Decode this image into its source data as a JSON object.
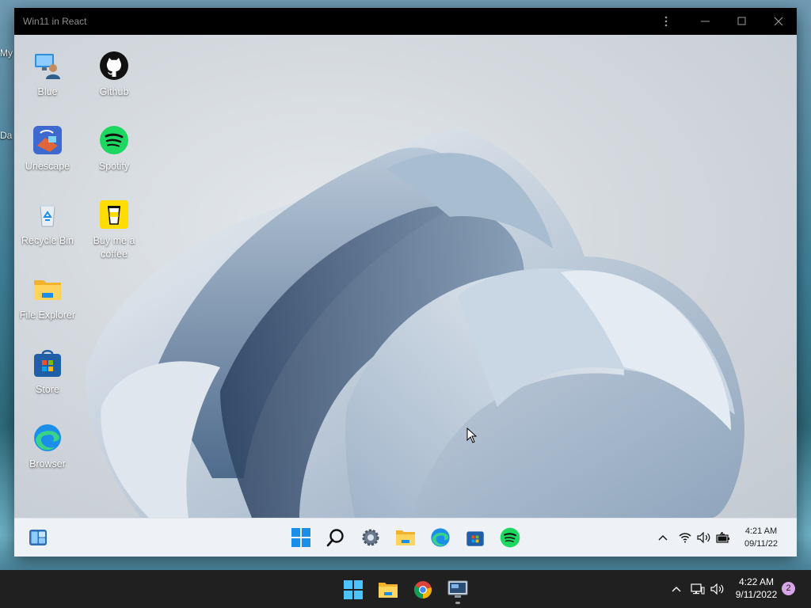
{
  "host_desktop": {
    "edge_text_1": "My",
    "edge_text_2": "Da"
  },
  "window": {
    "title": "Win11 in React",
    "buttons": [
      "menu-kebab-icon",
      "minimize-icon",
      "maximize-icon",
      "close-icon"
    ]
  },
  "desktop_icons": [
    {
      "label": "Blue",
      "icon": "user-pc-icon"
    },
    {
      "label": "Github",
      "icon": "github-icon"
    },
    {
      "label": "Unescape",
      "icon": "unescape-icon"
    },
    {
      "label": "Spotify",
      "icon": "spotify-icon"
    },
    {
      "label": "Recycle Bin",
      "icon": "recycle-bin-icon"
    },
    {
      "label": "Buy me a coffee",
      "icon": "coffee-cup-icon"
    },
    {
      "label": "File Explorer",
      "icon": "folder-icon"
    },
    {
      "label": "Store",
      "icon": "store-icon"
    },
    {
      "label": "Browser",
      "icon": "edge-icon"
    }
  ],
  "inner_taskbar": {
    "left": [
      "widgets-icon"
    ],
    "center": [
      "start-icon",
      "search-icon",
      "settings-icon",
      "file-explorer-icon",
      "edge-icon",
      "store-icon",
      "spotify-icon"
    ],
    "tray": [
      "chevron-up-icon",
      "wifi-icon",
      "volume-icon",
      "battery-icon"
    ],
    "time": "4:21 AM",
    "date": "09/11/22"
  },
  "host_taskbar": {
    "center": [
      "start-icon",
      "file-explorer-icon",
      "chrome-icon",
      "remote-desktop-icon"
    ],
    "tray": [
      "chevron-up-icon",
      "network-icon",
      "volume-icon"
    ],
    "time": "4:22 AM",
    "date": "9/11/2022",
    "notification_count": "2"
  },
  "colors": {
    "windows_blue": "#1a8ee8",
    "spotify_green": "#1ed760",
    "taskbar_light": "#eef2f6",
    "taskbar_dark": "#202020",
    "notification_badge": "#d7a6e8"
  }
}
